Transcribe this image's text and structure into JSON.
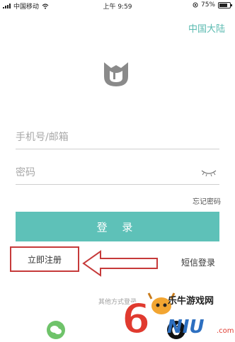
{
  "status_bar": {
    "carrier": "中国移动",
    "time": "上午 9:59",
    "battery": "75%",
    "battery_level": 0.75
  },
  "region_label": "中国大陆",
  "form": {
    "account_placeholder": "手机号/邮箱",
    "password_placeholder": "密码",
    "forgot_label": "忘记密码",
    "login_label": "登 录",
    "register_label": "立即注册",
    "sms_login_label": "短信登录",
    "other_methods_label": "其他方式登录"
  },
  "watermark": {
    "text": "乐牛游戏网",
    "brand_colors": {
      "six": "#e03a2f",
      "niu": "#2d6fc0"
    }
  },
  "icons": {
    "logo": "mi-home-logo",
    "eye": "eye-closed-icon",
    "wechat": "wechat-icon",
    "apple": "apple-icon"
  },
  "colors": {
    "accent": "#5ec1b8",
    "region_text": "#5abab0",
    "register_border": "#c63a3a"
  }
}
